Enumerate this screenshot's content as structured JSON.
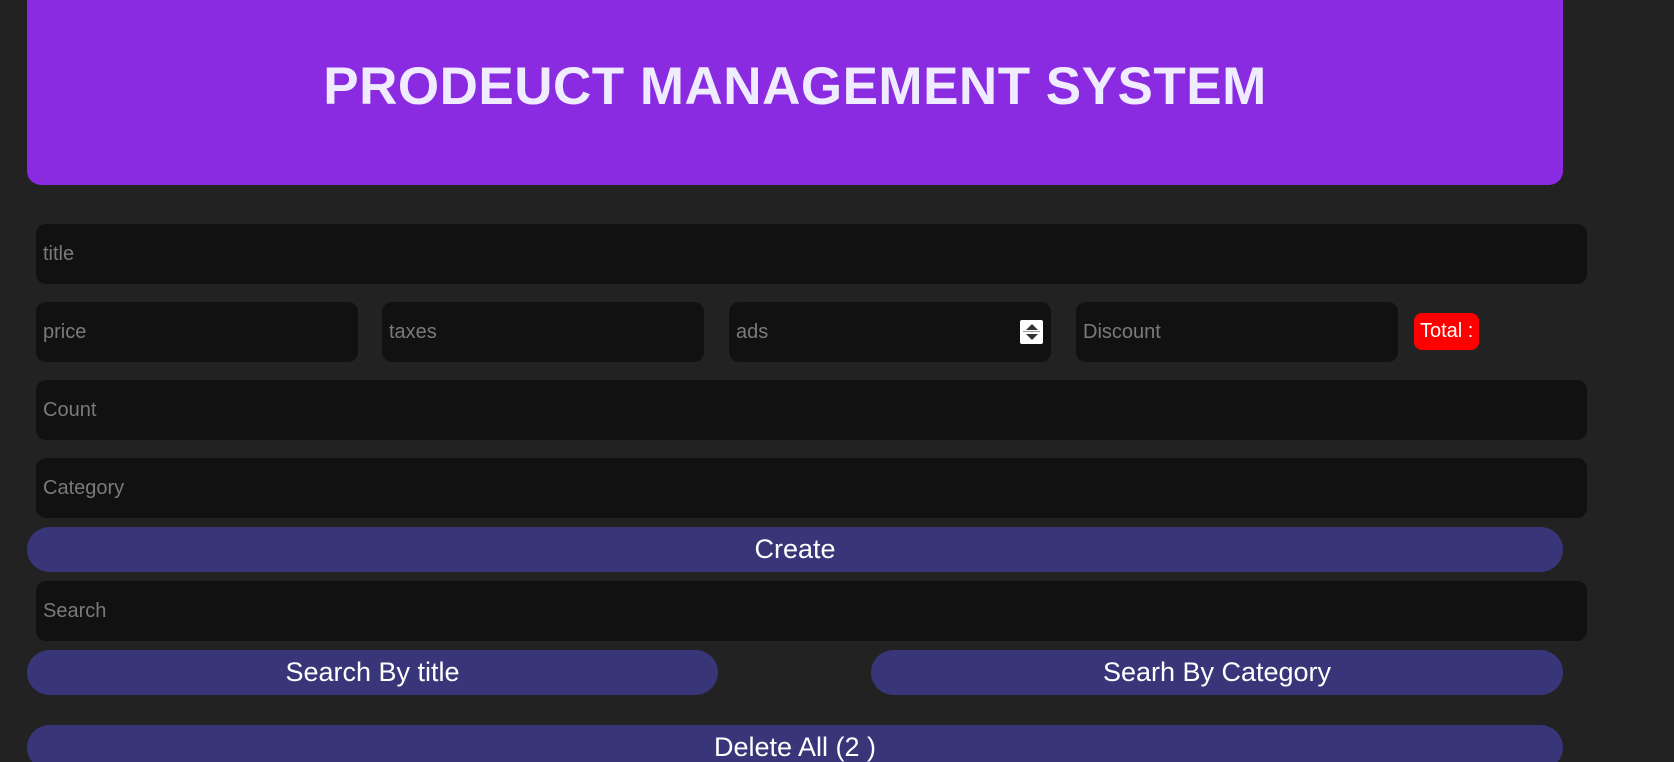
{
  "header": {
    "title": "PRODEUCT MANAGEMENT SYSTEM"
  },
  "form": {
    "title_placeholder": "title",
    "price_placeholder": "price",
    "taxes_placeholder": "taxes",
    "ads_placeholder": "ads",
    "discount_placeholder": "Discount",
    "total_label": "Total :",
    "count_placeholder": "Count",
    "category_placeholder": "Category",
    "create_label": "Create"
  },
  "search": {
    "placeholder": "Search",
    "by_title_label": "Search By title",
    "by_category_label": "Searh By Category"
  },
  "actions": {
    "delete_all_label": "Delete All (2 )"
  },
  "colors": {
    "background": "#222222",
    "header": "#8a2be2",
    "input": "#111111",
    "button": "#383579",
    "total_badge": "#ff0000"
  }
}
